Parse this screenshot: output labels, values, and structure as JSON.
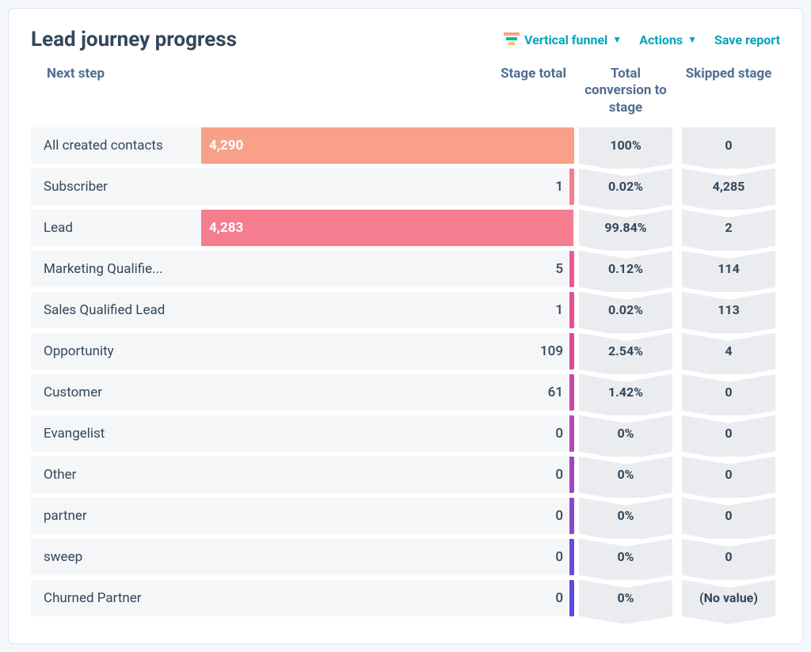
{
  "header": {
    "title": "Lead journey progress",
    "vertical_funnel": "Vertical funnel",
    "actions": "Actions",
    "save_report": "Save report"
  },
  "columns": {
    "next_step": "Next step",
    "stage_total": "Stage total",
    "conversion": "Total conversion to stage",
    "skipped": "Skipped stage"
  },
  "max_value": 4290,
  "stages": [
    {
      "label": "All created contacts",
      "value": 4290,
      "value_display": "4,290",
      "conversion": "100%",
      "skipped": "0",
      "color": "#f9a188",
      "tick": "#f9a188"
    },
    {
      "label": "Subscriber",
      "value": 1,
      "value_display": "1",
      "conversion": "0.02%",
      "skipped": "4,285",
      "color": "#f57d8f",
      "tick": "#f57d8f"
    },
    {
      "label": "Lead",
      "value": 4283,
      "value_display": "4,283",
      "conversion": "99.84%",
      "skipped": "2",
      "color": "#f57d8f",
      "tick": "#f57d8f"
    },
    {
      "label": "Marketing Qualifie...",
      "value": 5,
      "value_display": "5",
      "conversion": "0.12%",
      "skipped": "114",
      "color": "#ea5a8f",
      "tick": "#ea5a8f"
    },
    {
      "label": "Sales Qualified Lead",
      "value": 1,
      "value_display": "1",
      "conversion": "0.02%",
      "skipped": "113",
      "color": "#e84e92",
      "tick": "#e84e92"
    },
    {
      "label": "Opportunity",
      "value": 109,
      "value_display": "109",
      "conversion": "2.54%",
      "skipped": "4",
      "color": "#d94a9a",
      "tick": "#d94a9a"
    },
    {
      "label": "Customer",
      "value": 61,
      "value_display": "61",
      "conversion": "1.42%",
      "skipped": "0",
      "color": "#c74aa6",
      "tick": "#c74aa6"
    },
    {
      "label": "Evangelist",
      "value": 0,
      "value_display": "0",
      "conversion": "0%",
      "skipped": "0",
      "color": "#b14ab2",
      "tick": "#b14ab2"
    },
    {
      "label": "Other",
      "value": 0,
      "value_display": "0",
      "conversion": "0%",
      "skipped": "0",
      "color": "#9a4abe",
      "tick": "#9a4abe"
    },
    {
      "label": "partner",
      "value": 0,
      "value_display": "0",
      "conversion": "0%",
      "skipped": "0",
      "color": "#844aca",
      "tick": "#844aca"
    },
    {
      "label": "sweep",
      "value": 0,
      "value_display": "0",
      "conversion": "0%",
      "skipped": "0",
      "color": "#6d4ad6",
      "tick": "#6d4ad6"
    },
    {
      "label": "Churned Partner",
      "value": 0,
      "value_display": "0",
      "conversion": "0%",
      "skipped": "(No value)",
      "color": "#5a4ae0",
      "tick": "#5a4ae0"
    }
  ],
  "chart_data": {
    "type": "bar",
    "title": "Lead journey progress",
    "orientation": "horizontal",
    "xlabel": "Stage total",
    "ylabel": "Next step",
    "categories": [
      "All created contacts",
      "Subscriber",
      "Lead",
      "Marketing Qualified Lead",
      "Sales Qualified Lead",
      "Opportunity",
      "Customer",
      "Evangelist",
      "Other",
      "partner",
      "sweep",
      "Churned Partner"
    ],
    "series": [
      {
        "name": "Stage total",
        "values": [
          4290,
          1,
          4283,
          5,
          1,
          109,
          61,
          0,
          0,
          0,
          0,
          0
        ]
      },
      {
        "name": "Total conversion to stage (%)",
        "values": [
          100,
          0.02,
          99.84,
          0.12,
          0.02,
          2.54,
          1.42,
          0,
          0,
          0,
          0,
          0
        ]
      },
      {
        "name": "Skipped stage",
        "values": [
          0,
          4285,
          2,
          114,
          113,
          4,
          0,
          0,
          0,
          0,
          0,
          null
        ]
      }
    ],
    "xlim": [
      0,
      4290
    ]
  }
}
